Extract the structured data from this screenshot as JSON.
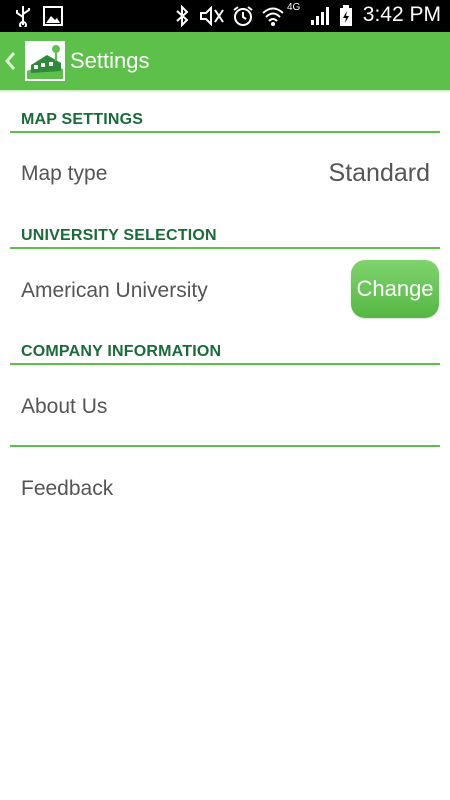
{
  "status_bar": {
    "time": "3:42 PM",
    "network_label": "4G",
    "icons": [
      "usb-icon",
      "image-icon",
      "bluetooth-icon",
      "mute-icon",
      "alarm-icon",
      "wifi-icon",
      "signal-icon",
      "battery-icon"
    ]
  },
  "action_bar": {
    "title": "Settings",
    "accent_color": "#5cc04a"
  },
  "sections": {
    "map": {
      "header": "MAP SETTINGS",
      "map_type_label": "Map type",
      "map_type_value": "Standard"
    },
    "university": {
      "header": "UNIVERSITY SELECTION",
      "selected": "American University",
      "change_label": "Change"
    },
    "company": {
      "header": "COMPANY INFORMATION",
      "about_label": "About Us",
      "feedback_label": "Feedback"
    }
  },
  "colors": {
    "header_text": "#1a6b3a",
    "item_text": "#555555",
    "divider": "#5cc04a"
  }
}
